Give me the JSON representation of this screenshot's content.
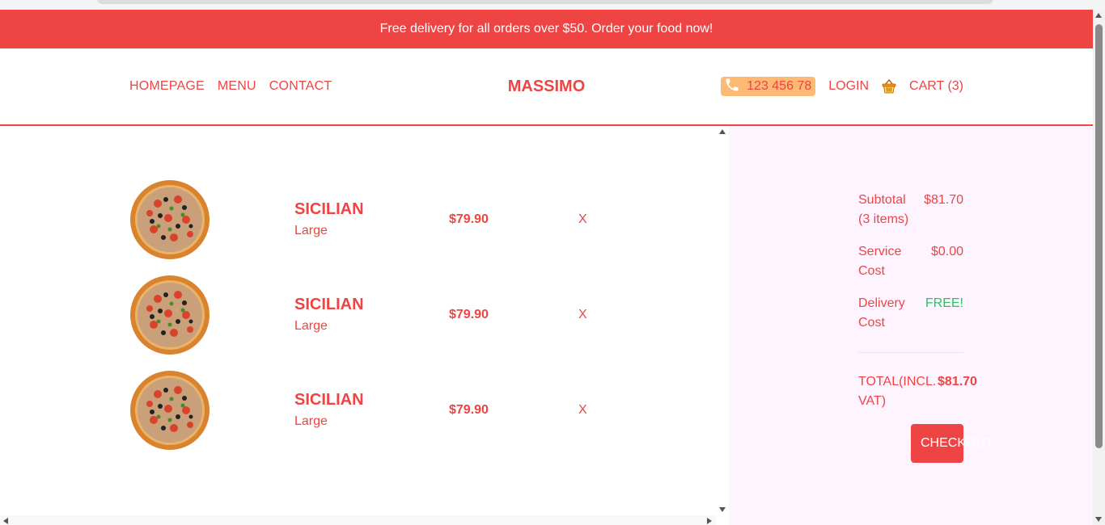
{
  "promo": {
    "text": "Free delivery for all orders over $50. Order your food now!"
  },
  "nav": {
    "links": [
      "HOMEPAGE",
      "MENU",
      "CONTACT"
    ],
    "brand": "MASSIMO",
    "phone": "123 456 78",
    "login": "LOGIN",
    "cart": "CART (3)"
  },
  "cart_items": [
    {
      "name": "SICILIAN",
      "size": "Large",
      "price": "$79.90",
      "remove": "X",
      "image": "pizza-image"
    },
    {
      "name": "SICILIAN",
      "size": "Large",
      "price": "$79.90",
      "remove": "X",
      "image": "pizza-image"
    },
    {
      "name": "SICILIAN",
      "size": "Large",
      "price": "$79.90",
      "remove": "X",
      "image": "pizza-image"
    }
  ],
  "summary": {
    "subtotal_label": "Subtotal (3 items)",
    "subtotal_value": "$81.70",
    "service_label": "Service Cost",
    "service_value": "$0.00",
    "delivery_label": "Delivery Cost",
    "delivery_value": "FREE!",
    "total_label": "TOTAL(INCL. VAT)",
    "total_value": "$81.70",
    "checkout": "CHECKOUT"
  },
  "colors": {
    "accent": "#ef4444",
    "phone_bg": "#fdba74",
    "summary_bg": "#fdf4ff",
    "free": "#22c55e"
  },
  "icons": [
    "phone-icon",
    "basket-icon"
  ]
}
